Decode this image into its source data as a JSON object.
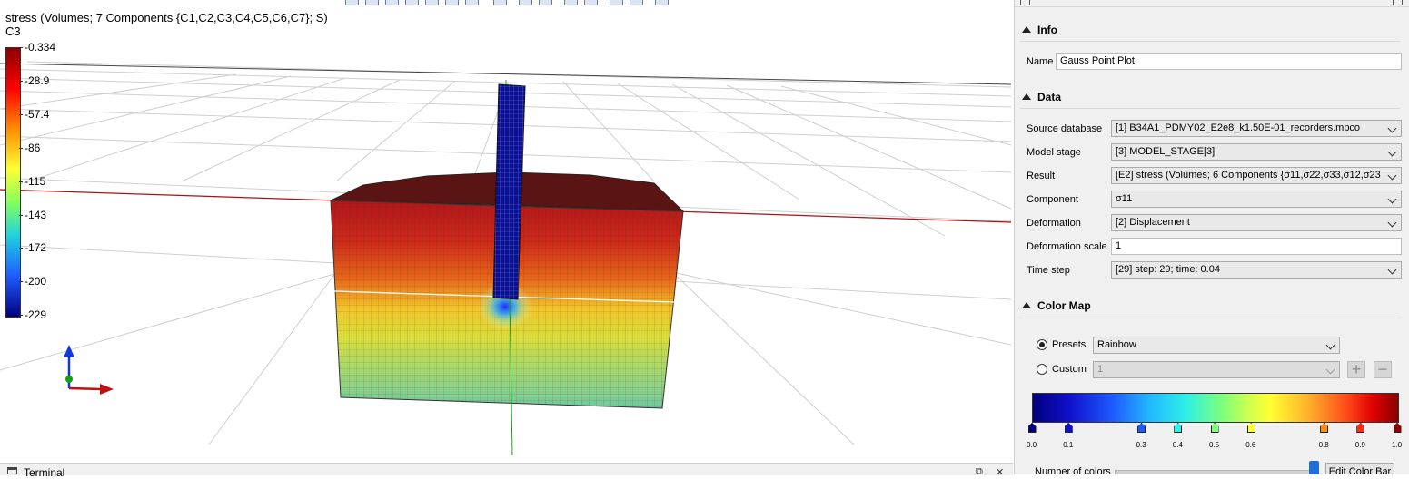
{
  "viewport": {
    "title": "stress (Volumes; 7 Components {C1,C2,C3,C4,C5,C6,C7}; S)",
    "component": "C3",
    "legend_ticks": [
      "-0.334",
      "-28.9",
      "-57.4",
      "-86",
      "-115",
      "-143",
      "-172",
      "-200",
      "-229"
    ],
    "legend_colors": [
      "#8b0000",
      "#ff0000",
      "#ff8c00",
      "#ffff33",
      "#7fff5f",
      "#1fd0e0",
      "#1e5bff",
      "#00007f"
    ]
  },
  "terminal": {
    "label": "Terminal"
  },
  "panel": {
    "info": {
      "header": "Info",
      "name_label": "Name",
      "name_value": "Gauss Point Plot"
    },
    "data": {
      "header": "Data",
      "rows": [
        {
          "label": "Source database",
          "value": "[1] B34A1_PDMY02_E2e8_k1.50E-01_recorders.mpco",
          "type": "combo"
        },
        {
          "label": "Model stage",
          "value": "[3] MODEL_STAGE[3]",
          "type": "combo"
        },
        {
          "label": "Result",
          "value": "[E2] stress (Volumes; 6 Components {σ11,σ22,σ33,σ12,σ23,σ13}; S)",
          "type": "combo"
        },
        {
          "label": "Component",
          "value": "σ11",
          "type": "combo"
        },
        {
          "label": "Deformation",
          "value": "[2] Displacement",
          "type": "combo"
        },
        {
          "label": "Deformation scale",
          "value": "1",
          "type": "text"
        },
        {
          "label": "Time step",
          "value": "[29] step: 29; time: 0.04",
          "type": "combo"
        }
      ]
    },
    "color_map": {
      "header": "Color Map",
      "presets_label": "Presets",
      "presets_value": "Rainbow",
      "custom_label": "Custom",
      "custom_value": "1",
      "stops": [
        {
          "label": "0.0",
          "color": "#00007f"
        },
        {
          "label": "0.1",
          "color": "#1010cc"
        },
        {
          "label": "0.3",
          "color": "#1e5bff"
        },
        {
          "label": "0.4",
          "color": "#2ef0e6"
        },
        {
          "label": "0.5",
          "color": "#7fff7a"
        },
        {
          "label": "0.6",
          "color": "#ffff33"
        },
        {
          "label": "0.8",
          "color": "#ff8c1a"
        },
        {
          "label": "0.9",
          "color": "#ff2a1a"
        },
        {
          "label": "1.0",
          "color": "#8b0000"
        }
      ],
      "number_of_colors_label": "Number of colors",
      "edit_button": "Edit Color Bar"
    }
  }
}
